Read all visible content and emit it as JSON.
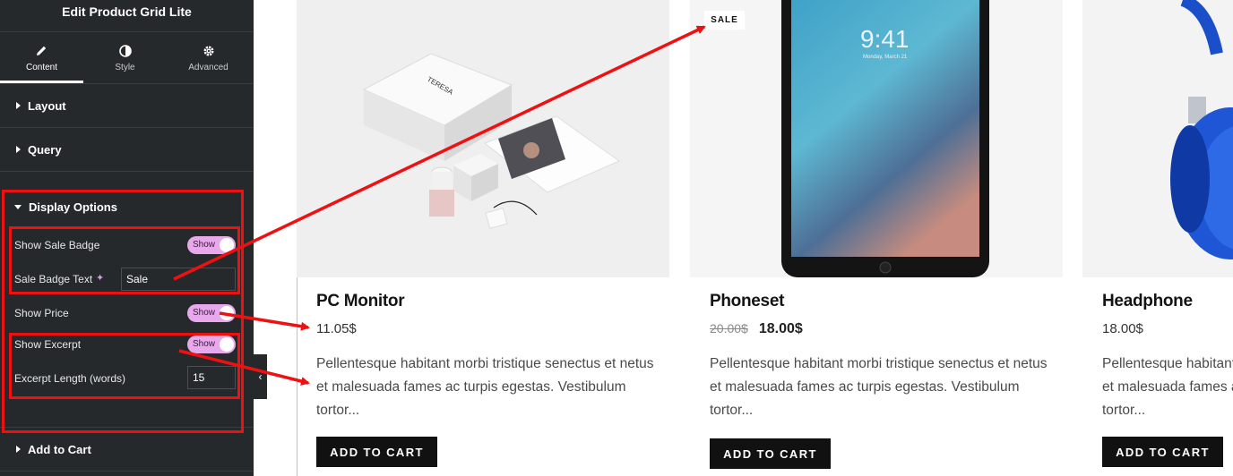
{
  "sidebar": {
    "title": "Edit Product Grid Lite",
    "tabs": [
      {
        "label": "Content",
        "icon": "pencil-icon"
      },
      {
        "label": "Style",
        "icon": "contrast-icon"
      },
      {
        "label": "Advanced",
        "icon": "gear-icon"
      }
    ],
    "sections": {
      "layout": "Layout",
      "query": "Query",
      "display_options": "Display Options",
      "add_to_cart": "Add to Cart"
    },
    "controls": {
      "show_sale_badge": {
        "label": "Show Sale Badge",
        "value": "Show"
      },
      "sale_badge_text": {
        "label": "Sale Badge Text",
        "value": "Sale"
      },
      "show_price": {
        "label": "Show Price",
        "value": "Show"
      },
      "show_excerpt": {
        "label": "Show Excerpt",
        "value": "Show"
      },
      "excerpt_length": {
        "label": "Excerpt Length (words)",
        "value": "15"
      }
    },
    "collapse_glyph": "‹"
  },
  "products": [
    {
      "name": "PC Monitor",
      "price": "11.05$",
      "old_price": "",
      "description": "Pellentesque habitant morbi tristique senectus et netus et malesuada fames ac turpis egestas. Vestibulum tortor...",
      "button": "ADD TO CART",
      "sale_badge": ""
    },
    {
      "name": "Phoneset",
      "price": "18.00$",
      "old_price": "20.00$",
      "description": "Pellentesque habitant morbi tristique senectus et netus et malesuada fames ac turpis egestas. Vestibulum tortor...",
      "button": "ADD TO CART",
      "sale_badge": "SALE",
      "screen_time": "9:41",
      "screen_date": "Monday, March 21"
    },
    {
      "name": "Headphone",
      "price": "18.00$",
      "old_price": "",
      "description": "Pellentesque habitant morbi tristique senectus et netus et malesuada fames ac turpis egestas. Vestibulum tortor...",
      "button": "ADD TO CART",
      "sale_badge": ""
    }
  ],
  "colors": {
    "sidebar_bg": "#26292c",
    "toggle_on": "#e8a9ec",
    "annotation_red": "#ee1111",
    "button_bg": "#111111"
  }
}
